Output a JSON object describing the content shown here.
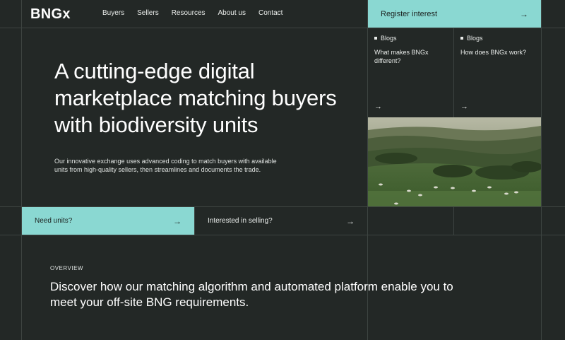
{
  "header": {
    "logo": "BNGx",
    "nav": [
      "Buyers",
      "Sellers",
      "Resources",
      "About us",
      "Contact"
    ],
    "register_label": "Register interest"
  },
  "blogs": [
    {
      "tag": "Blogs",
      "title": "What makes BNGx different?"
    },
    {
      "tag": "Blogs",
      "title": "How does BNGx work?"
    }
  ],
  "hero": {
    "title": "A cutting-edge digital marketplace matching buyers with biodiversity units",
    "subtitle": "Our innovative exchange uses advanced coding to match buyers with available units from high-quality sellers, then streamlines and documents the trade."
  },
  "cta": {
    "need_label": "Need units?",
    "sell_label": "Interested in selling?"
  },
  "overview": {
    "label": "OVERVIEW",
    "text": "Discover how our matching algorithm and automated platform enable you to meet your off-site BNG requirements."
  },
  "icons": {
    "arrow": "→"
  },
  "colors": {
    "background": "#232826",
    "accent": "#8ad8d2"
  }
}
